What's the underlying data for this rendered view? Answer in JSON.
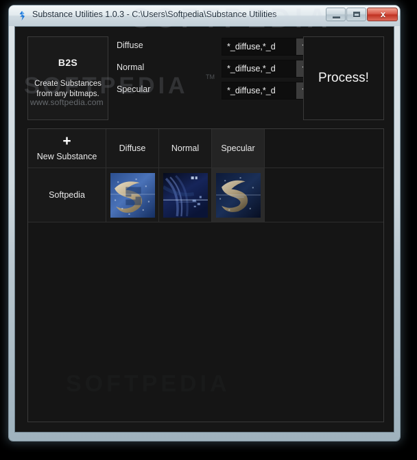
{
  "window": {
    "title": "Substance Utilities 1.0.3 - C:\\Users\\Softpedia\\Substance Utilities",
    "app_icon": "substance-icon",
    "controls": {
      "minimize": "minimize-icon",
      "maximize": "maximize-icon",
      "close_label": "x"
    }
  },
  "b2s": {
    "title": "B2S",
    "description_line1": "Create Substances",
    "description_line2": "from any bitmaps."
  },
  "fields": [
    {
      "label": "Diffuse",
      "value": "*_diffuse,*_d",
      "arrow_icon": "chevron-down-icon"
    },
    {
      "label": "Normal",
      "value": "*_diffuse,*_d",
      "arrow_icon": "chevron-down-icon"
    },
    {
      "label": "Specular",
      "value": "*_diffuse,*_d",
      "arrow_icon": "chevron-down-icon"
    }
  ],
  "process": {
    "label": "Process!"
  },
  "grid": {
    "headers": {
      "new_substance": "New Substance",
      "plus_icon": "+",
      "diffuse": "Diffuse",
      "normal": "Normal",
      "specular": "Specular"
    },
    "rows": [
      {
        "name": "Softpedia",
        "thumbnails": [
          {
            "name": "diffuse-thumbnail",
            "alt": "blue S logo diffuse map"
          },
          {
            "name": "normal-thumbnail",
            "alt": "dark blue abstract normal map"
          },
          {
            "name": "specular-thumbnail",
            "alt": "dark S logo specular map"
          }
        ]
      }
    ]
  },
  "watermark": {
    "big": "SOFTPEDIA",
    "tm": "TM",
    "big2": "SOFTPEDIA",
    "url": "www.softpedia.com"
  },
  "colors": {
    "window_frame": "#cdd7dd",
    "client_bg": "#161616",
    "panel_bg": "#1a1a1a",
    "panel_border": "#3a3a3a",
    "combo_bg": "#0e0e0e",
    "combo_button": "#3c3c3c",
    "text": "#e9e9e9",
    "close_button": "#bf3222",
    "selected_cell": "#2a2a2a"
  }
}
